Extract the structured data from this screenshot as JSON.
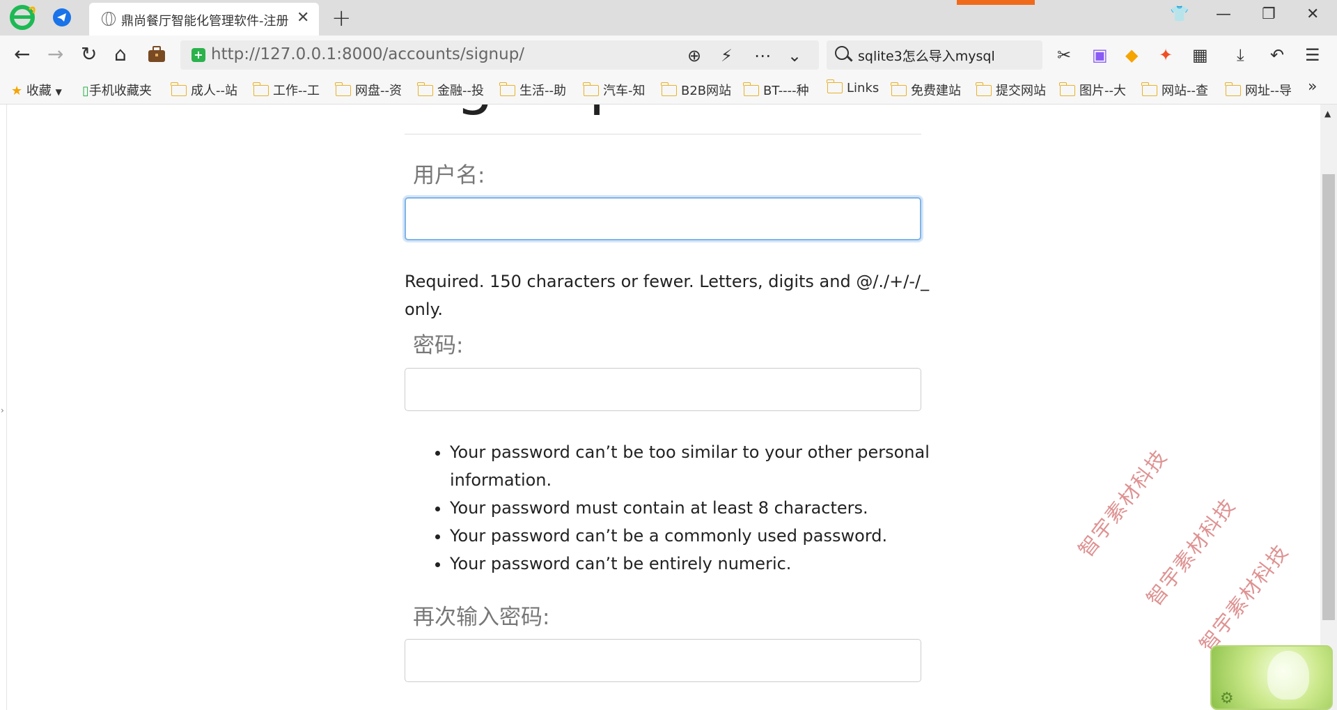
{
  "browser": {
    "tab_title": "鼎尚餐厅智能化管理软件-注册",
    "url_host": "http://127.0.0.1:8000/accounts/signup/",
    "search_query": "sqlite3怎么导入mysql"
  },
  "bookmarks": [
    {
      "label": "收藏"
    },
    {
      "label": "手机收藏夹"
    },
    {
      "label": "成人--站"
    },
    {
      "label": "工作--工"
    },
    {
      "label": "网盘--资"
    },
    {
      "label": "金融--投"
    },
    {
      "label": "生活--助"
    },
    {
      "label": "汽车-知"
    },
    {
      "label": "B2B网站"
    },
    {
      "label": "BT----种"
    },
    {
      "label": "Links"
    },
    {
      "label": "免费建站"
    },
    {
      "label": "提交网站"
    },
    {
      "label": "图片--大"
    },
    {
      "label": "网站--查"
    },
    {
      "label": "网址--导"
    }
  ],
  "form": {
    "heading_partial": "Sign up",
    "username_label": "用户名:",
    "username_value": "",
    "username_help": "Required. 150 characters or fewer. Letters, digits and @/./+/-/_ only.",
    "password_label": "密码:",
    "password_value": "",
    "password_rules": [
      "Your password can’t be too similar to your other personal information.",
      "Your password must contain at least 8 characters.",
      "Your password can’t be a commonly used password.",
      "Your password can’t be entirely numeric."
    ],
    "confirm_label": "再次输入密码:",
    "confirm_value": ""
  },
  "watermark": "智宇素材科技",
  "colors": {
    "accent_focus": "#7fb4e8",
    "watermark": "#d98080",
    "tab_bar": "#dedede",
    "folder": "#e8b22a"
  },
  "icons": [
    "browser-logo-icon",
    "telegram-icon",
    "globe-icon",
    "close-icon",
    "plus-icon",
    "shirt-icon",
    "minimize-icon",
    "restore-icon",
    "back-icon",
    "forward-icon",
    "reload-icon",
    "home-icon",
    "briefcase-icon",
    "shield-icon",
    "zoom-icon",
    "lightning-icon",
    "more-icon",
    "chevron-down-icon",
    "search-icon",
    "scissors-icon",
    "translate-icon",
    "coupon-icon",
    "game-icon",
    "apps-icon",
    "download-icon",
    "undo-icon",
    "menu-icon",
    "star-icon",
    "phone-icon",
    "folder-icon"
  ]
}
